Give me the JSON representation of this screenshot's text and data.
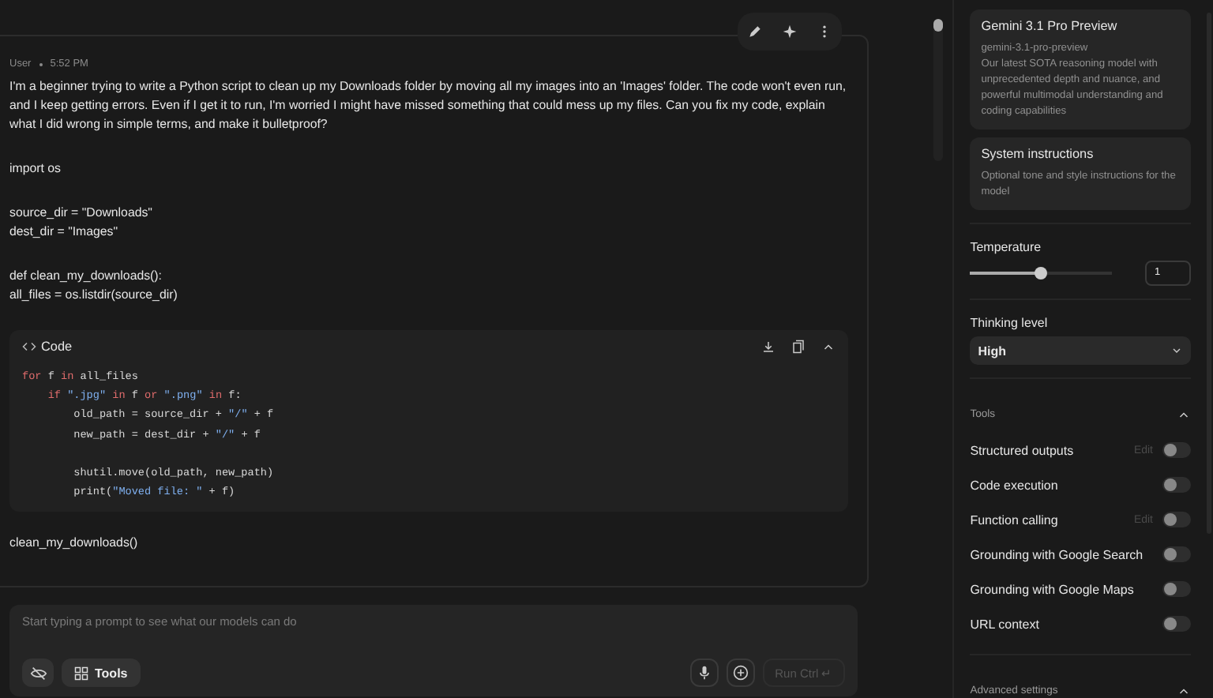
{
  "message": {
    "author": "User",
    "time": "5:52 PM",
    "paragraphs": [
      "I'm a beginner trying to write a Python script to clean up my Downloads folder by moving all my images into an 'Images' folder. The code won't even run, and I keep getting errors. Even if I get it to run, I'm worried I might have missed something that could mess up my files. Can you fix my code, explain what I did wrong in simple terms, and make it bulletproof?",
      "import os",
      "source_dir = \"Downloads\"\ndest_dir = \"Images\"",
      "def clean_my_downloads():\nall_files = os.listdir(source_dir)"
    ],
    "code_block": {
      "title": "Code",
      "lines": [
        {
          "tokens": [
            {
              "kind": "keyword",
              "text": "for "
            },
            {
              "kind": "plain",
              "text": "f "
            },
            {
              "kind": "keyword",
              "text": "in "
            },
            {
              "kind": "plain",
              "text": "all_files"
            }
          ]
        },
        {
          "tokens": [
            {
              "kind": "keyword",
              "text": "    if "
            },
            {
              "kind": "string",
              "text": "\".jpg\""
            },
            {
              "kind": "keyword",
              "text": " in "
            },
            {
              "kind": "plain",
              "text": "f "
            },
            {
              "kind": "keyword",
              "text": "or "
            },
            {
              "kind": "string",
              "text": "\".png\""
            },
            {
              "kind": "keyword",
              "text": " in "
            },
            {
              "kind": "plain",
              "text": "f:"
            }
          ]
        },
        {
          "tokens": [
            {
              "kind": "plain",
              "text": "        old_path = source_dir + "
            },
            {
              "kind": "string",
              "text": "\"/\""
            },
            {
              "kind": "plain",
              "text": " + f"
            }
          ]
        },
        {
          "tokens": [
            {
              "kind": "plain",
              "text": "        new_path = dest_dir + "
            },
            {
              "kind": "string",
              "text": "\"/\""
            },
            {
              "kind": "plain",
              "text": " + f"
            }
          ]
        },
        {
          "blank_before": true,
          "tokens": [
            {
              "kind": "plain",
              "text": "        shutil.move(old_path, new_path)"
            }
          ]
        },
        {
          "tokens": [
            {
              "kind": "plain",
              "text": "        print("
            },
            {
              "kind": "string",
              "text": "\"Moved file: \""
            },
            {
              "kind": "plain",
              "text": " + f)"
            }
          ]
        }
      ]
    },
    "trailing_text": "clean_my_downloads()"
  },
  "prompt": {
    "placeholder": "Start typing a prompt to see what our models can do",
    "tools_label": "Tools",
    "run_label": "Run Ctrl ↵"
  },
  "settings": {
    "model": {
      "name": "Gemini 3.1 Pro Preview",
      "id": "gemini-3.1-pro-preview",
      "description": "Our latest SOTA reasoning model with unprecedented depth and nuance, and powerful multimodal understanding and coding capabilities"
    },
    "system_instructions": {
      "title": "System instructions",
      "hint": "Optional tone and style instructions for the model"
    },
    "temperature": {
      "label": "Temperature",
      "level": 0.5,
      "value": "1"
    },
    "thinking_level": {
      "label": "Thinking level",
      "value": "High"
    },
    "tools": {
      "title": "Tools",
      "expanded": true,
      "items": [
        {
          "label": "Structured outputs",
          "edit": "Edit",
          "on": false
        },
        {
          "label": "Code execution",
          "on": false
        },
        {
          "label": "Function calling",
          "edit": "Edit",
          "on": false
        },
        {
          "label": "Grounding with Google Search",
          "on": false
        },
        {
          "label": "Grounding with Google Maps",
          "on": false
        },
        {
          "label": "URL context",
          "on": false
        }
      ]
    },
    "advanced": {
      "title": "Advanced settings",
      "expanded": true
    }
  }
}
